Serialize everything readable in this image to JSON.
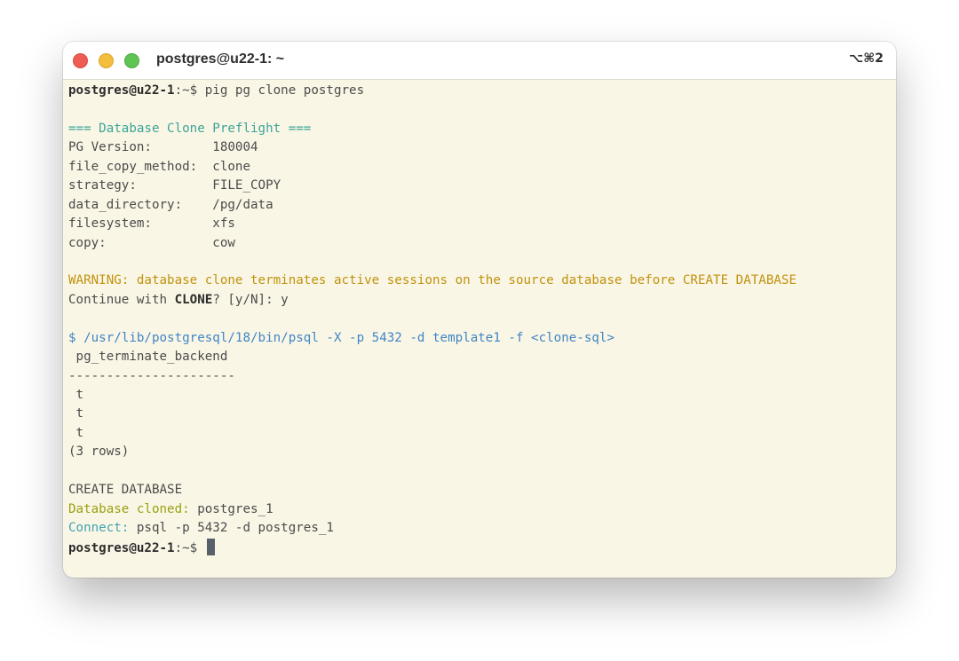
{
  "window": {
    "title": "postgres@u22-1: ~",
    "shortcut": "⌥⌘2"
  },
  "colors": {
    "background": "#faf6e6",
    "heading": "#3aa597",
    "warning": "#c0920e",
    "command": "#3f86c4",
    "success": "#97a20e",
    "connect": "#3fa3b0"
  },
  "terminal": {
    "prompt_user": "postgres@u22-1",
    "prompt_path": ":~$",
    "command": " pig pg clone postgres",
    "preflight_header": "=== Database Clone Preflight ===",
    "preflight": [
      {
        "key": "PG Version:        ",
        "value": "180004"
      },
      {
        "key": "file_copy_method:  ",
        "value": "clone"
      },
      {
        "key": "strategy:          ",
        "value": "FILE_COPY"
      },
      {
        "key": "data_directory:    ",
        "value": "/pg/data"
      },
      {
        "key": "filesystem:        ",
        "value": "xfs"
      },
      {
        "key": "copy:              ",
        "value": "cow"
      }
    ],
    "warning": "WARNING: database clone terminates active sessions on the source database before CREATE DATABASE",
    "confirm_prefix": "Continue with ",
    "confirm_keyword": "CLONE",
    "confirm_suffix": "? [y/N]: y",
    "psql_command": "$ /usr/lib/postgresql/18/bin/psql -X -p 5432 -d template1 -f <clone-sql>",
    "column_header": " pg_terminate_backend",
    "separator": "----------------------",
    "rows": [
      " t",
      " t",
      " t"
    ],
    "row_count": "(3 rows)",
    "create_result": "CREATE DATABASE",
    "cloned_label": "Database cloned:",
    "cloned_value": " postgres_1",
    "connect_label": "Connect:",
    "connect_value": " psql -p 5432 -d postgres_1"
  }
}
